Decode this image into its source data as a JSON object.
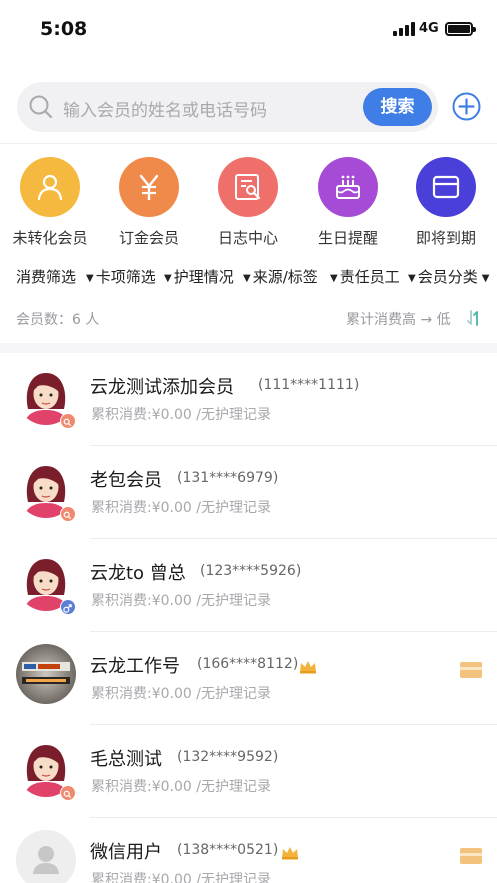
{
  "status_bar": {
    "time": "5:08",
    "network": "4G"
  },
  "search": {
    "placeholder": "输入会员的姓名或电话号码",
    "button_label": "搜索"
  },
  "quick_actions": [
    {
      "label": "未转化会员",
      "icon": "person-icon",
      "color": "#f5b93f"
    },
    {
      "label": "订金会员",
      "icon": "yen-icon",
      "color": "#f08a4b"
    },
    {
      "label": "日志中心",
      "icon": "log-search-icon",
      "color": "#ef6f6b"
    },
    {
      "label": "生日提醒",
      "icon": "cake-icon",
      "color": "#a64bd6"
    },
    {
      "label": "即将到期",
      "icon": "card-icon",
      "color": "#4a3fd9"
    }
  ],
  "filters": [
    "消费筛选",
    "卡项筛选",
    "护理情况",
    "来源/标签",
    "责任员工",
    "会员分类"
  ],
  "summary": {
    "member_count": "会员数：6 人",
    "sort_label": "累计消费高 → 低"
  },
  "members": [
    {
      "name": "云龙测试添加会员",
      "phone": "(111****1111)",
      "sub": "累积消费:¥0.00 /无护理记录",
      "avatar": "female-avatar",
      "badge": "search",
      "vip": false,
      "card": false
    },
    {
      "name": "老包会员",
      "phone": "(131****6979)",
      "sub": "累积消费:¥0.00 /无护理记录",
      "avatar": "female-avatar",
      "badge": "search",
      "vip": false,
      "card": false
    },
    {
      "name": "云龙to 曾总",
      "phone": "(123****5926)",
      "sub": "累积消费:¥0.00 /无护理记录",
      "avatar": "female-avatar",
      "badge": "male",
      "vip": false,
      "card": false
    },
    {
      "name": "云龙工作号",
      "phone": "(166****8112)",
      "sub": "累积消费:¥0.00 /无护理记录",
      "avatar": "photo-avatar",
      "badge": "",
      "vip": true,
      "card": true
    },
    {
      "name": "毛总测试",
      "phone": "(132****9592)",
      "sub": "累积消费:¥0.00 /无护理记录",
      "avatar": "female-avatar",
      "badge": "search",
      "vip": false,
      "card": false
    },
    {
      "name": "微信用户",
      "phone": "(138****0521)",
      "sub": "累积消费:¥0.00 /无护理记录",
      "avatar": "default-avatar",
      "badge": "",
      "vip": true,
      "card": true
    }
  ],
  "colors": {
    "accent": "#3f7ee6",
    "card": "#f3c27c",
    "crown": "#f2b23c",
    "badge_search": "#ef8a6e",
    "badge_male": "#5b7fd8"
  }
}
